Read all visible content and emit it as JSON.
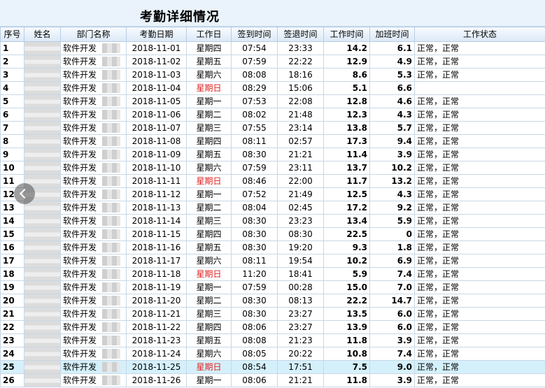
{
  "page": {
    "title": "考勤详细情况"
  },
  "columns": [
    "序号",
    "姓名",
    "部门名称",
    "考勤日期",
    "工作日",
    "签到时间",
    "签退时间",
    "工作时间",
    "加班时间",
    "工作状态"
  ],
  "rows": [
    {
      "seq": "1",
      "name": "",
      "dept": "软件开发",
      "date": "2018-11-01",
      "day": "星期四",
      "in": "07:54",
      "out": "23:33",
      "work": "14.2",
      "ot": "6.1",
      "status": "正常，正常",
      "sunday": false
    },
    {
      "seq": "2",
      "name": "",
      "dept": "软件开发",
      "date": "2018-11-02",
      "day": "星期五",
      "in": "07:59",
      "out": "22:22",
      "work": "12.9",
      "ot": "4.9",
      "status": "正常，正常",
      "sunday": false
    },
    {
      "seq": "3",
      "name": "",
      "dept": "软件开发",
      "date": "2018-11-03",
      "day": "星期六",
      "in": "08:08",
      "out": "18:16",
      "work": "8.6",
      "ot": "5.3",
      "status": "正常，正常",
      "sunday": false
    },
    {
      "seq": "4",
      "name": "",
      "dept": "软件开发",
      "date": "2018-11-04",
      "day": "星期日",
      "in": "08:29",
      "out": "15:06",
      "work": "5.1",
      "ot": "6.6",
      "status": "",
      "sunday": true
    },
    {
      "seq": "5",
      "name": "",
      "dept": "软件开发",
      "date": "2018-11-05",
      "day": "星期一",
      "in": "07:53",
      "out": "22:08",
      "work": "12.8",
      "ot": "4.6",
      "status": "正常，正常",
      "sunday": false
    },
    {
      "seq": "6",
      "name": "",
      "dept": "软件开发",
      "date": "2018-11-06",
      "day": "星期二",
      "in": "08:02",
      "out": "21:48",
      "work": "12.3",
      "ot": "4.3",
      "status": "正常，正常",
      "sunday": false
    },
    {
      "seq": "7",
      "name": "",
      "dept": "软件开发",
      "date": "2018-11-07",
      "day": "星期三",
      "in": "07:55",
      "out": "23:14",
      "work": "13.8",
      "ot": "5.7",
      "status": "正常，正常",
      "sunday": false
    },
    {
      "seq": "8",
      "name": "",
      "dept": "软件开发",
      "date": "2018-11-08",
      "day": "星期四",
      "in": "08:11",
      "out": "02:57",
      "work": "17.3",
      "ot": "9.4",
      "status": "正常，正常",
      "sunday": false
    },
    {
      "seq": "9",
      "name": "",
      "dept": "软件开发",
      "date": "2018-11-09",
      "day": "星期五",
      "in": "08:30",
      "out": "21:21",
      "work": "11.4",
      "ot": "3.9",
      "status": "正常，正常",
      "sunday": false
    },
    {
      "seq": "10",
      "name": "",
      "dept": "软件开发",
      "date": "2018-11-10",
      "day": "星期六",
      "in": "07:59",
      "out": "23:11",
      "work": "13.7",
      "ot": "10.2",
      "status": "正常，正常",
      "sunday": false
    },
    {
      "seq": "11",
      "name": "",
      "dept": "软件开发",
      "date": "2018-11-11",
      "day": "星期日",
      "in": "08:46",
      "out": "22:00",
      "work": "11.7",
      "ot": "13.2",
      "status": "正常，正常",
      "sunday": true
    },
    {
      "seq": "12",
      "name": "",
      "dept": "软件开发",
      "date": "2018-11-12",
      "day": "星期一",
      "in": "07:52",
      "out": "21:49",
      "work": "12.5",
      "ot": "4.3",
      "status": "正常，正常",
      "sunday": false
    },
    {
      "seq": "13",
      "name": "",
      "dept": "软件开发",
      "date": "2018-11-13",
      "day": "星期二",
      "in": "08:04",
      "out": "02:45",
      "work": "17.2",
      "ot": "9.2",
      "status": "正常，正常",
      "sunday": false
    },
    {
      "seq": "14",
      "name": "",
      "dept": "软件开发",
      "date": "2018-11-14",
      "day": "星期三",
      "in": "08:30",
      "out": "23:23",
      "work": "13.4",
      "ot": "5.9",
      "status": "正常，正常",
      "sunday": false
    },
    {
      "seq": "15",
      "name": "",
      "dept": "软件开发",
      "date": "2018-11-15",
      "day": "星期四",
      "in": "08:30",
      "out": "08:30",
      "work": "22.5",
      "ot": "0",
      "status": "正常，正常",
      "sunday": false
    },
    {
      "seq": "16",
      "name": "",
      "dept": "软件开发",
      "date": "2018-11-16",
      "day": "星期五",
      "in": "08:30",
      "out": "19:20",
      "work": "9.3",
      "ot": "1.8",
      "status": "正常，正常",
      "sunday": false
    },
    {
      "seq": "17",
      "name": "",
      "dept": "软件开发",
      "date": "2018-11-17",
      "day": "星期六",
      "in": "08:11",
      "out": "19:54",
      "work": "10.2",
      "ot": "6.9",
      "status": "正常，正常",
      "sunday": false
    },
    {
      "seq": "18",
      "name": "",
      "dept": "软件开发",
      "date": "2018-11-18",
      "day": "星期日",
      "in": "11:20",
      "out": "18:41",
      "work": "5.9",
      "ot": "7.4",
      "status": "正常，正常",
      "sunday": true
    },
    {
      "seq": "19",
      "name": "",
      "dept": "软件开发",
      "date": "2018-11-19",
      "day": "星期一",
      "in": "07:59",
      "out": "00:28",
      "work": "15.0",
      "ot": "7.0",
      "status": "正常，正常",
      "sunday": false
    },
    {
      "seq": "20",
      "name": "",
      "dept": "软件开发",
      "date": "2018-11-20",
      "day": "星期二",
      "in": "08:30",
      "out": "08:13",
      "work": "22.2",
      "ot": "14.7",
      "status": "正常，正常",
      "sunday": false
    },
    {
      "seq": "21",
      "name": "",
      "dept": "软件开发",
      "date": "2018-11-21",
      "day": "星期三",
      "in": "08:30",
      "out": "23:27",
      "work": "13.5",
      "ot": "6.0",
      "status": "正常，正常",
      "sunday": false
    },
    {
      "seq": "22",
      "name": "",
      "dept": "软件开发",
      "date": "2018-11-22",
      "day": "星期四",
      "in": "08:06",
      "out": "23:27",
      "work": "13.9",
      "ot": "6.0",
      "status": "正常，正常",
      "sunday": false
    },
    {
      "seq": "23",
      "name": "",
      "dept": "软件开发",
      "date": "2018-11-23",
      "day": "星期五",
      "in": "08:08",
      "out": "21:23",
      "work": "11.8",
      "ot": "3.9",
      "status": "正常，正常",
      "sunday": false
    },
    {
      "seq": "24",
      "name": "",
      "dept": "软件开发",
      "date": "2018-11-24",
      "day": "星期六",
      "in": "08:05",
      "out": "20:22",
      "work": "10.8",
      "ot": "7.4",
      "status": "正常，正常",
      "sunday": false
    },
    {
      "seq": "25",
      "name": "",
      "dept": "软件开发",
      "date": "2018-11-25",
      "day": "星期日",
      "in": "08:54",
      "out": "17:51",
      "work": "7.5",
      "ot": "9.0",
      "status": "正常，正常",
      "sunday": true
    },
    {
      "seq": "26",
      "name": "",
      "dept": "软件开发",
      "date": "2018-11-26",
      "day": "星期一",
      "in": "08:06",
      "out": "21:21",
      "work": "11.8",
      "ot": "3.9",
      "status": "正常，正常",
      "sunday": false
    }
  ],
  "highlight_row": 24,
  "colors": {
    "sunday": "#e01f1f",
    "highlight": "#d4f0fb",
    "header_bg": "#dbe8f6"
  }
}
